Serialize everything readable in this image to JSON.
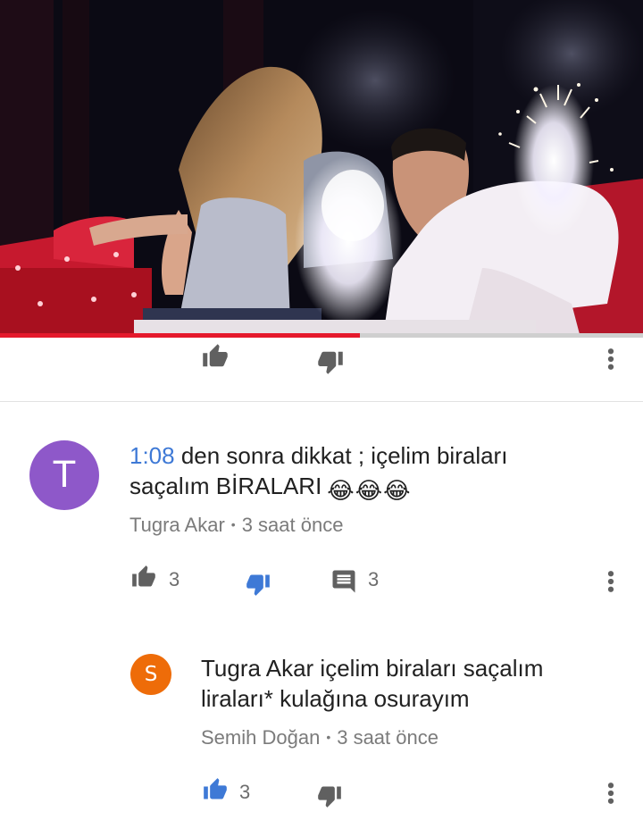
{
  "video": {
    "progress_fraction": 0.56
  },
  "video_actions": {
    "like_icon": "thumb-up-icon",
    "dislike_icon": "thumb-down-icon",
    "more_icon": "more-vertical-icon"
  },
  "comments": [
    {
      "avatar_letter": "T",
      "avatar_color": "#8e58c9",
      "timestamp": "1:08",
      "text": " den sonra dikkat ; içelim biraları saçalım BİRALARI",
      "emojis": [
        "😂",
        "😂",
        "😂"
      ],
      "author": "Tugra Akar",
      "separator": "•",
      "time": "3 saat önce",
      "likes": "3",
      "replies": "3",
      "disliked": true
    },
    {
      "avatar_letter": "S",
      "avatar_color": "#ee6c09",
      "text": "Tugra Akar içelim biraları saçalım liraları* kulağına osurayım",
      "author": "Semih Doğan",
      "separator": "•",
      "time": "3 saat önce",
      "likes": "3",
      "liked": true
    }
  ],
  "colors": {
    "accent_blue": "#3e79d6",
    "progress_red": "#e5192c",
    "icon_gray": "#606060"
  }
}
